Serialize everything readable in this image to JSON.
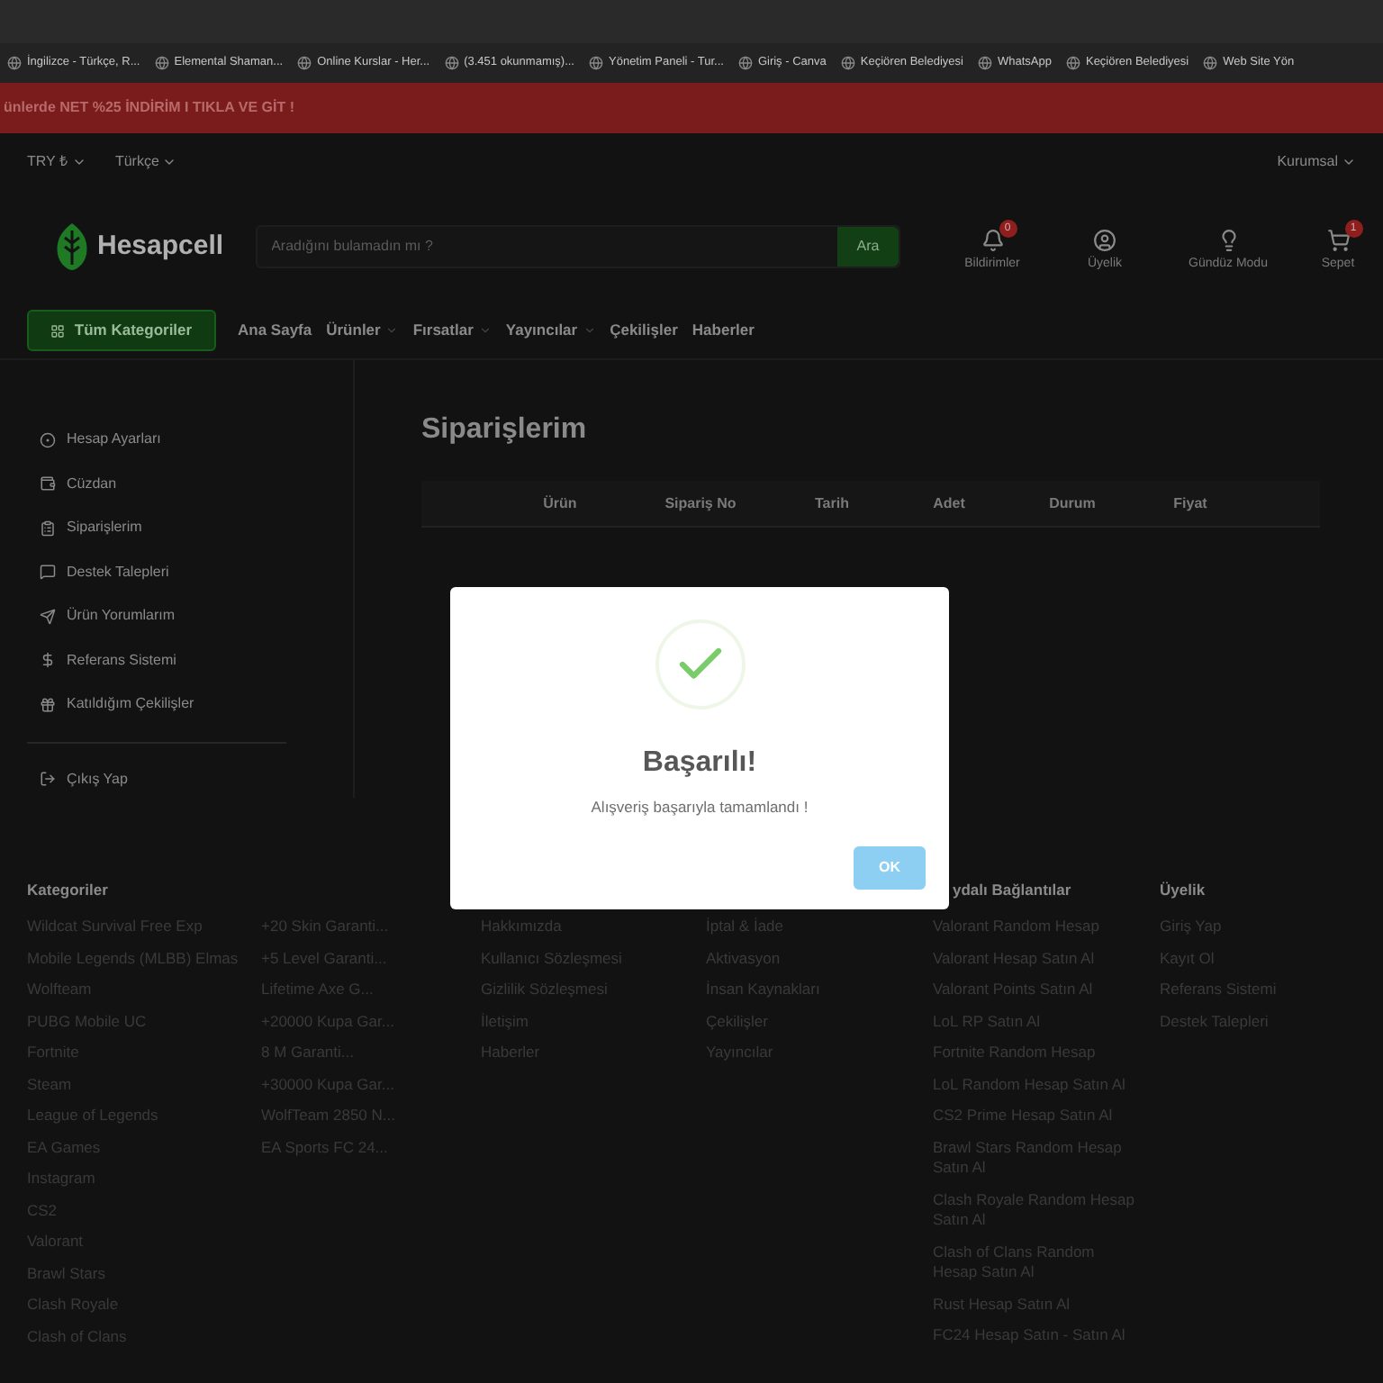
{
  "bookmarks": [
    "İngilizce - Türkçe, R...",
    "Elemental Shaman...",
    "Online Kurslar - Her...",
    "(3.451 okunmamış)...",
    "Yönetim Paneli - Tur...",
    "Giriş - Canva",
    "Keçiören Belediyesi",
    "WhatsApp",
    "Keçiören Belediyesi",
    "Web Site Yön"
  ],
  "banner": "ünlerde NET %25 İNDİRİM I TIKLA VE GİT !",
  "top_bar": {
    "currency": "TRY ₺",
    "language": "Türkçe",
    "corporate": "Kurumsal"
  },
  "header": {
    "logo": "Hesapcell",
    "search": {
      "placeholder": "Aradığını bulamadın mı ?",
      "button": "Ara"
    },
    "actions": [
      {
        "label": "Bildirimler",
        "badge": "0"
      },
      {
        "label": "Üyelik"
      },
      {
        "label": "Gündüz Modu"
      },
      {
        "label": "Sepet",
        "badge": "1"
      }
    ]
  },
  "nav": {
    "all_categories": "Tüm Kategoriler",
    "items": [
      {
        "label": "Ana Sayfa",
        "has_menu": false
      },
      {
        "label": "Ürünler",
        "has_menu": true
      },
      {
        "label": "Fırsatlar",
        "has_menu": true
      },
      {
        "label": "Yayıncılar",
        "has_menu": true
      },
      {
        "label": "Çekilişler",
        "has_menu": false
      },
      {
        "label": "Haberler",
        "has_menu": false
      }
    ]
  },
  "sidebar": {
    "items": [
      "Hesap Ayarları",
      "Cüzdan",
      "Siparişlerim",
      "Destek Talepleri",
      "Ürün Yorumlarım",
      "Referans Sistemi",
      "Katıldığım Çekilişler"
    ],
    "logout": "Çıkış Yap"
  },
  "orders": {
    "title": "Siparişlerim",
    "columns": [
      "Ürün",
      "Sipariş No",
      "Tarih",
      "Adet",
      "Durum",
      "Fiyat"
    ]
  },
  "footer": {
    "columns": [
      {
        "heading": "Kategoriler",
        "items": [
          "Wildcat Survival Free Exp",
          "Mobile Legends (MLBB) Elmas",
          "Wolfteam",
          "PUBG Mobile UC",
          "Fortnite",
          "Steam",
          "League of Legends",
          "EA Games",
          "Instagram",
          "CS2",
          "Valorant",
          "Brawl Stars",
          "Clash Royale",
          "Clash of Clans"
        ]
      },
      {
        "items": [
          "+20 Skin Garanti...",
          "+5 Level Garanti...",
          "Lifetime Axe G...",
          "+20000 Kupa Gar...",
          "8 M Garanti...",
          "+30000 Kupa Gar...",
          "WolfTeam 2850 N...",
          "EA Sports FC 24..."
        ]
      },
      {
        "items": [
          "Hakkımızda",
          "Kullanıcı Sözleşmesi",
          "Gizlilik Sözleşmesi",
          "İletişim",
          "Haberler"
        ]
      },
      {
        "items": [
          "İptal & İade",
          "Aktivasyon",
          "İnsan Kaynakları",
          "Çekilişler",
          "Yayıncılar"
        ]
      },
      {
        "heading": "ydalı Bağlantılar",
        "items": [
          "Valorant Random Hesap",
          "Valorant Hesap Satın Al",
          "Valorant Points Satın Al",
          "LoL RP Satın Al",
          "Fortnite Random Hesap",
          "LoL Random Hesap Satın Al",
          "CS2 Prime Hesap Satın Al",
          "Brawl Stars Random Hesap Satın Al",
          "Clash Royale Random Hesap Satın Al",
          "Clash of Clans Random Hesap Satın Al",
          "Rust Hesap Satın Al",
          "FC24 Hesap Satın - Satın Al"
        ]
      },
      {
        "heading": "Üyelik",
        "items": [
          "Giriş Yap",
          "Kayıt Ol",
          "Referans Sistemi",
          "Destek Talepleri"
        ]
      }
    ]
  },
  "dialog": {
    "title": "Başarılı!",
    "message": "Alışveriş başarıyla tamamlandı !",
    "button": "OK"
  }
}
